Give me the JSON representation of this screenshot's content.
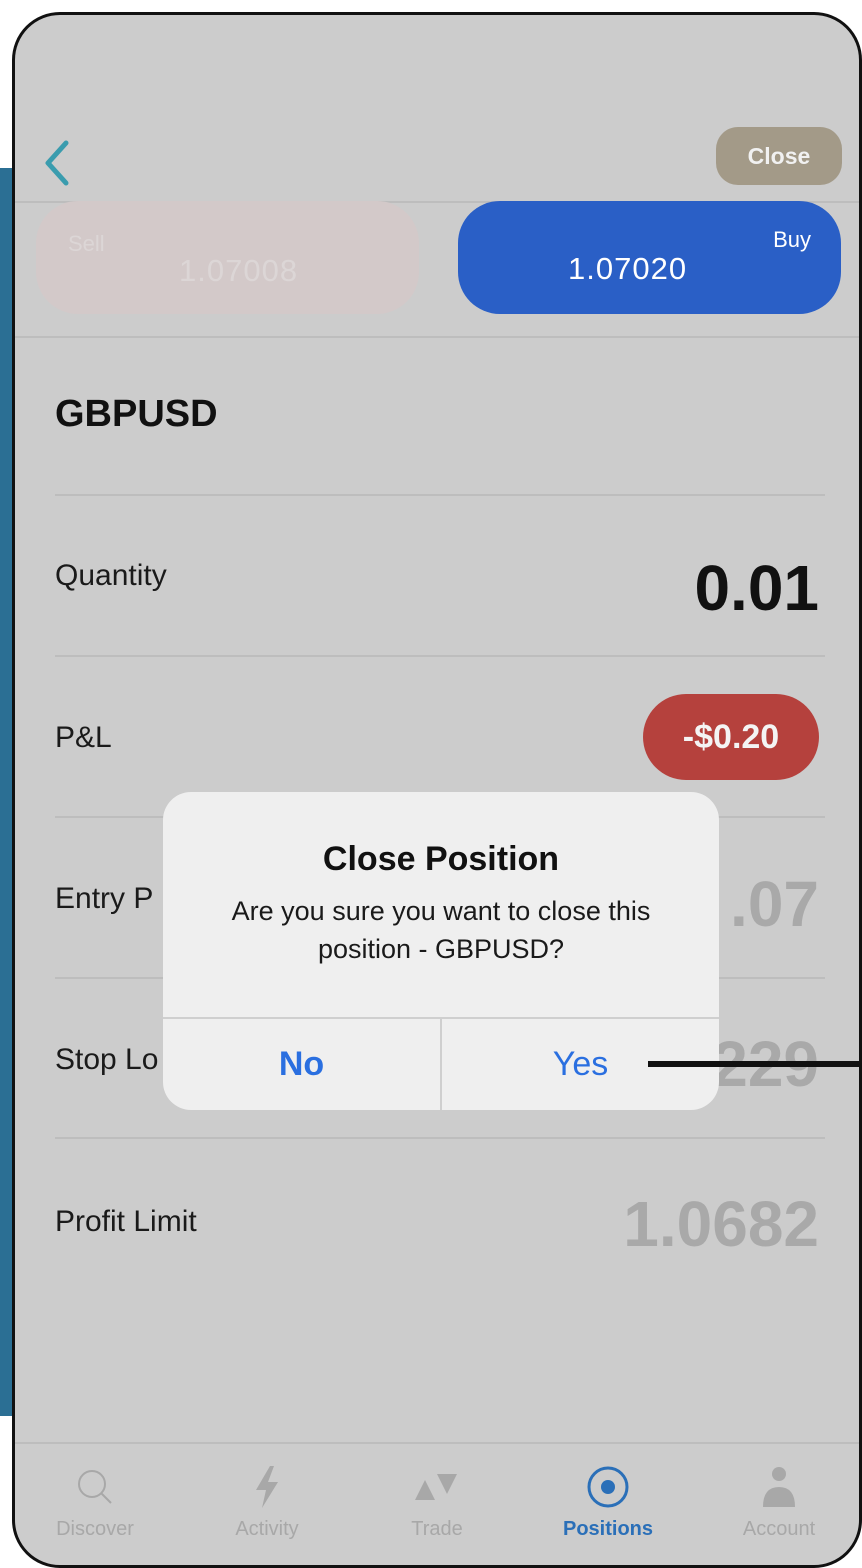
{
  "header": {
    "close_label": "Close"
  },
  "quote": {
    "sell_label": "Sell",
    "sell_price": "1.07008",
    "buy_label": "Buy",
    "buy_price": "1.07020"
  },
  "position": {
    "symbol": "GBPUSD",
    "rows": [
      {
        "label": "Quantity",
        "value": "0.01"
      },
      {
        "label": "P&L",
        "value": "-$0.20"
      },
      {
        "label": "Entry P",
        "value": ".07"
      },
      {
        "label": "Stop Lo",
        "value": "229"
      },
      {
        "label": "Profit Limit",
        "value": "1.0682"
      }
    ]
  },
  "dialog": {
    "title": "Close Position",
    "message": "Are you sure you want to close this position - GBPUSD?",
    "no_label": "No",
    "yes_label": "Yes"
  },
  "tabs": [
    {
      "label": "Discover",
      "icon": "search-icon",
      "active": false
    },
    {
      "label": "Activity",
      "icon": "lightning-icon",
      "active": false
    },
    {
      "label": "Trade",
      "icon": "trade-arrows-icon",
      "active": false
    },
    {
      "label": "Positions",
      "icon": "target-icon",
      "active": true
    },
    {
      "label": "Account",
      "icon": "person-icon",
      "active": false
    }
  ],
  "colors": {
    "buy": "#2a5fc6",
    "loss": "#b5413d",
    "active_tab": "#2a6fb8",
    "dialog_action": "#2a6fe0"
  }
}
